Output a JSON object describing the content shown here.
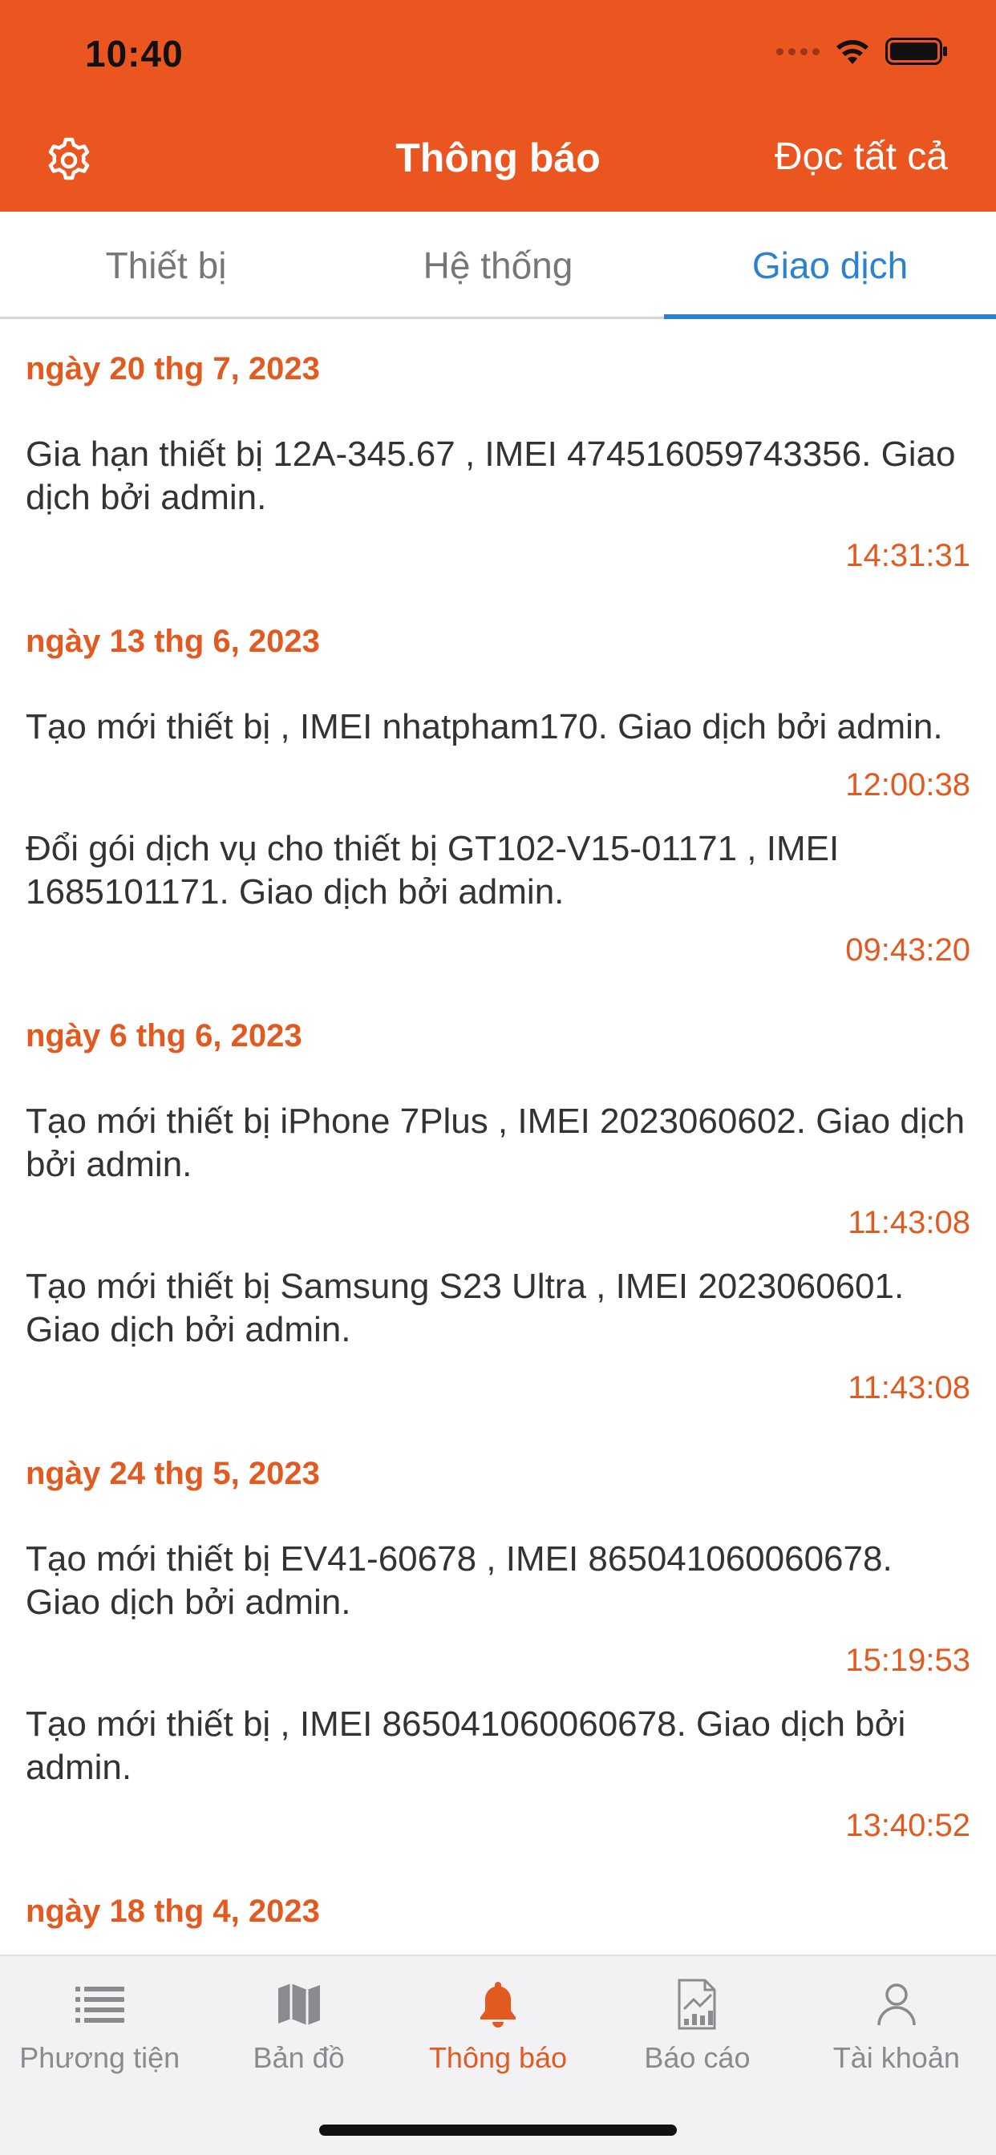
{
  "status": {
    "time": "10:40"
  },
  "header": {
    "title": "Thông báo",
    "read_all": "Đọc tất cả"
  },
  "tabs": [
    {
      "label": "Thiết bị",
      "active": false
    },
    {
      "label": "Hệ thống",
      "active": false
    },
    {
      "label": "Giao dịch",
      "active": true
    }
  ],
  "groups": [
    {
      "date": "ngày 20 thg 7, 2023",
      "items": [
        {
          "text": "Gia hạn thiết bị 12A-345.67 , IMEI 474516059743356. Giao dịch bởi admin.",
          "time": "14:31:31"
        }
      ]
    },
    {
      "date": "ngày 13 thg 6, 2023",
      "items": [
        {
          "text": "Tạo mới thiết bị  , IMEI nhatpham170. Giao dịch bởi admin.",
          "time": "12:00:38"
        },
        {
          "text": "Đổi gói dịch vụ cho thiết bị GT102-V15-01171 , IMEI 1685101171. Giao dịch bởi admin.",
          "time": "09:43:20"
        }
      ]
    },
    {
      "date": "ngày 6 thg 6, 2023",
      "items": [
        {
          "text": "Tạo mới thiết bị iPhone 7Plus , IMEI 2023060602. Giao dịch bởi admin.",
          "time": "11:43:08"
        },
        {
          "text": "Tạo mới thiết bị Samsung S23 Ultra , IMEI 2023060601. Giao dịch bởi admin.",
          "time": "11:43:08"
        }
      ]
    },
    {
      "date": "ngày 24 thg 5, 2023",
      "items": [
        {
          "text": "Tạo mới thiết bị EV41-60678 , IMEI 865041060060678. Giao dịch bởi admin.",
          "time": "15:19:53"
        },
        {
          "text": "Tạo mới thiết bị  , IMEI 865041060060678. Giao dịch bởi admin.",
          "time": "13:40:52"
        }
      ]
    },
    {
      "date": "ngày 18 thg 4, 2023",
      "items": []
    }
  ],
  "nav": [
    {
      "label": "Phương tiện",
      "icon": "list-icon",
      "active": false
    },
    {
      "label": "Bản đồ",
      "icon": "map-icon",
      "active": false
    },
    {
      "label": "Thông báo",
      "icon": "bell-icon",
      "active": true
    },
    {
      "label": "Báo cáo",
      "icon": "report-icon",
      "active": false
    },
    {
      "label": "Tài khoản",
      "icon": "user-icon",
      "active": false
    }
  ],
  "colors": {
    "accent": "#EA5520",
    "tab_active": "#2A82D0",
    "date": "#E35A21"
  }
}
